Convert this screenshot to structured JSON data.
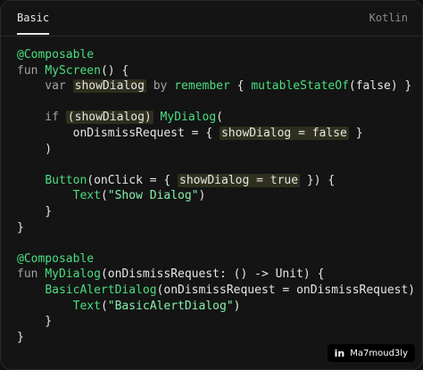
{
  "tabs": {
    "active": "Basic",
    "language": "Kotlin"
  },
  "code": {
    "l1": "@Composable",
    "l2a": "fun ",
    "l2b": "MyScreen",
    "l2c": "() {",
    "l3a": "    var ",
    "l3b": "showDialog",
    "l3c": " by ",
    "l3d": "remember",
    "l3e": " { ",
    "l3f": "mutableStateOf",
    "l3g": "(false) }",
    "l4": "",
    "l5a": "    if ",
    "l5b": "(showDialog)",
    "l5c": " ",
    "l5d": "MyDialog",
    "l5e": "(",
    "l6a": "        onDismissRequest = { ",
    "l6b": "showDialog = false",
    "l6c": " }",
    "l7": "    )",
    "l8": "",
    "l9a": "    ",
    "l9b": "Button",
    "l9c": "(onClick = { ",
    "l9d": "showDialog = true",
    "l9e": " }) {",
    "l10a": "        ",
    "l10b": "Text",
    "l10c": "(",
    "l10d": "\"Show Dialog\"",
    "l10e": ")",
    "l11": "    }",
    "l12": "}",
    "l13": "",
    "l14": "@Composable",
    "l15a": "fun ",
    "l15b": "MyDialog",
    "l15c": "(onDismissRequest: () -> Unit) {",
    "l16a": "    ",
    "l16b": "BasicAlertDialog",
    "l16c": "(onDismissRequest = onDismissRequest) {",
    "l17a": "        ",
    "l17b": "Text",
    "l17c": "(",
    "l17d": "\"BasicAlertDialog\"",
    "l17e": ")",
    "l18": "    }",
    "l19": "}"
  },
  "badge": {
    "icon": "in",
    "label": "Ma7moud3ly"
  }
}
